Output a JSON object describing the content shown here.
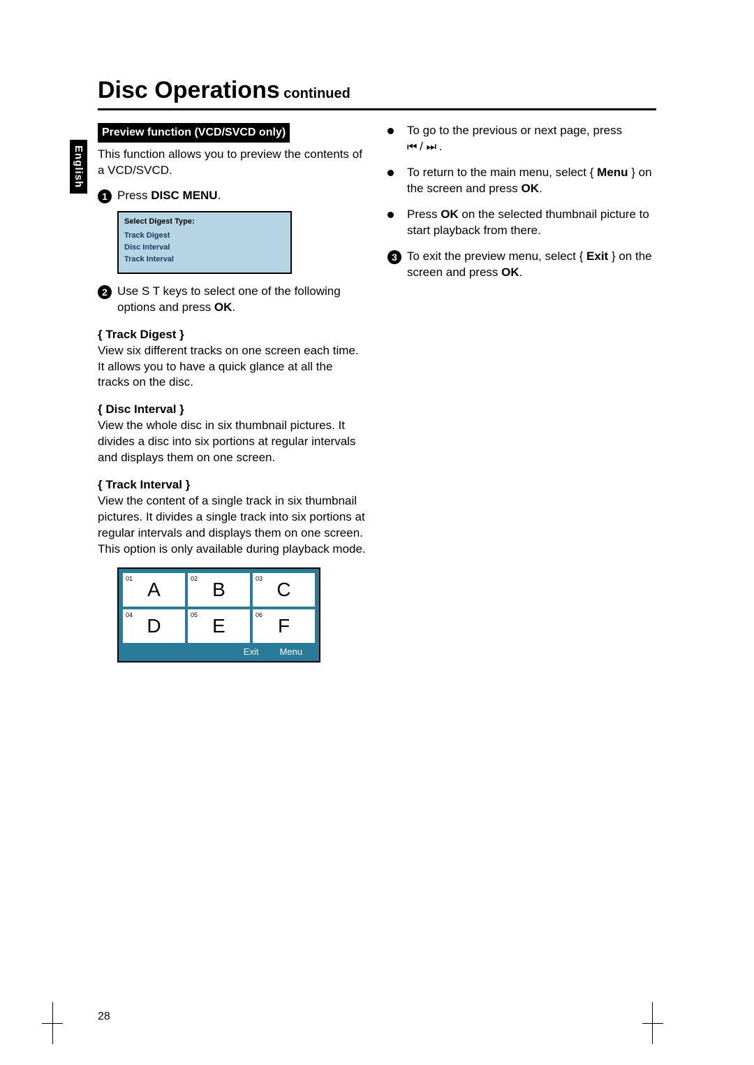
{
  "title": {
    "main": "Disc Operations",
    "sub": " continued"
  },
  "side_tab": "English",
  "page_number": "28",
  "left": {
    "section_heading": "Preview function (VCD/SVCD only)",
    "intro": "This function allows you to preview the contents of a VCD/SVCD.",
    "step1_prefix": "Press ",
    "step1_bold": "DISC MENU",
    "step1_suffix": ".",
    "menu": {
      "title": "Select Digest Type:",
      "items": [
        "Track Digest",
        "Disc Interval",
        "Track Interval"
      ]
    },
    "step2_a": "Use S T keys to select one of the following options and press ",
    "step2_ok": "OK",
    "step2_b": ".",
    "opt1_name": "Track Digest",
    "opt1_text": "View six different tracks on one screen each time. It allows you to have a quick glance at all the tracks on the disc.",
    "opt2_name": "Disc Interval",
    "opt2_text": "View the whole disc in six thumbnail pictures. It divides a disc into six portions at regular intervals and displays them on one screen.",
    "opt3_name": "Track Interval",
    "opt3_text": "View the content of a single track in six thumbnail pictures. It divides a single track into six portions at regular intervals and displays them on one screen. This option is only available during playback mode.",
    "thumbs": [
      {
        "num": "01",
        "big": "A"
      },
      {
        "num": "02",
        "big": "B"
      },
      {
        "num": "03",
        "big": "C"
      },
      {
        "num": "04",
        "big": "D"
      },
      {
        "num": "05",
        "big": "E"
      },
      {
        "num": "06",
        "big": "F"
      }
    ],
    "thumb_footer": {
      "exit": "Exit",
      "menu": "Menu"
    }
  },
  "right": {
    "b1_a": "To go to the previous or next page, press ",
    "b1_prev": "⏮",
    "b1_sep": " / ",
    "b1_next": "⏭",
    "b1_b": " .",
    "b2_a": "To return to the main menu, select { ",
    "b2_menu": "Menu",
    "b2_b": " } on the screen and press ",
    "b2_ok": "OK",
    "b2_c": ".",
    "b3_a": "Press ",
    "b3_ok": "OK",
    "b3_b": " on the selected thumbnail picture to start playback from there.",
    "s3_a": "To exit the preview menu, select { ",
    "s3_exit": "Exit",
    "s3_b": " } on the screen and press ",
    "s3_ok": "OK",
    "s3_c": "."
  }
}
